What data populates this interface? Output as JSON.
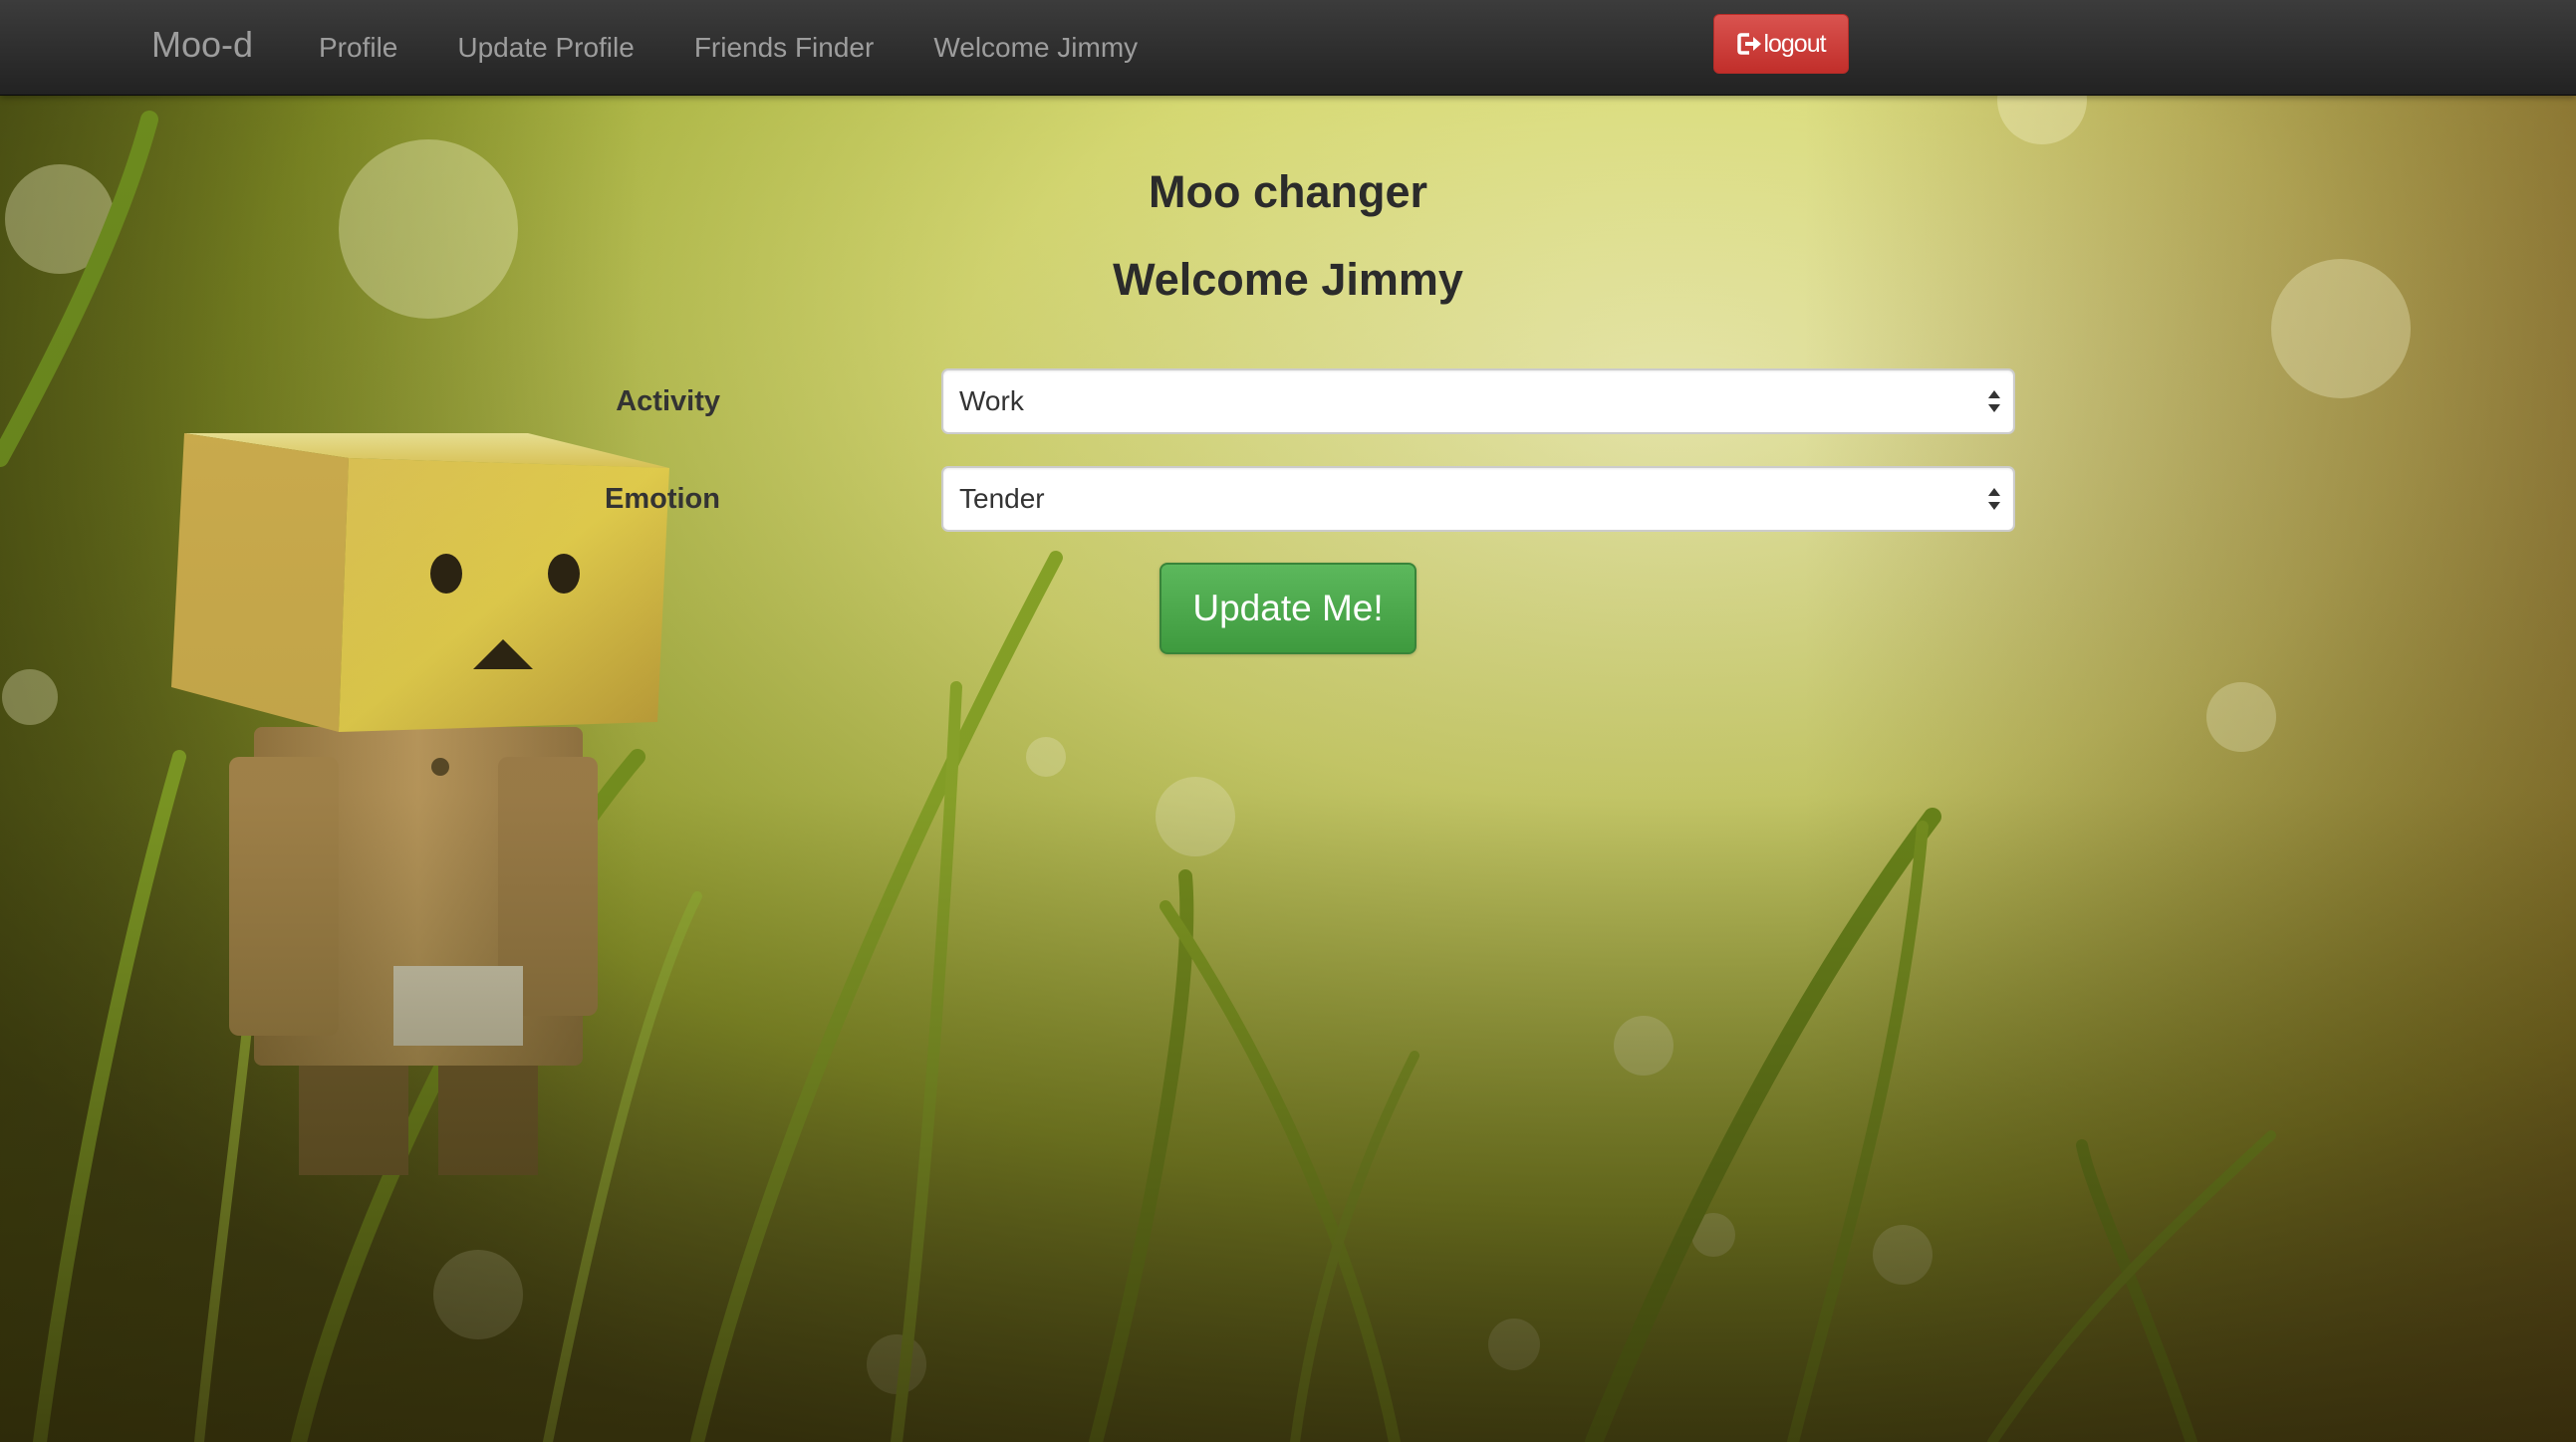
{
  "navbar": {
    "brand": "Moo-d",
    "links": [
      {
        "label": "Profile"
      },
      {
        "label": "Update Profile"
      },
      {
        "label": "Friends Finder"
      },
      {
        "label": "Welcome Jimmy"
      }
    ],
    "logout_label": "logout",
    "logout_icon": "log-out-icon",
    "logout_color": "#d9534f"
  },
  "main": {
    "title": "Moo changer",
    "welcome": "Welcome Jimmy",
    "activity": {
      "label": "Activity",
      "selected": "Work"
    },
    "emotion": {
      "label": "Emotion",
      "selected": "Tender"
    },
    "submit_label": "Update Me!",
    "submit_color": "#5cb85c"
  },
  "background": {
    "description_icon": "grass-field-with-cardboard-robot",
    "accent": "#c8d24a"
  }
}
